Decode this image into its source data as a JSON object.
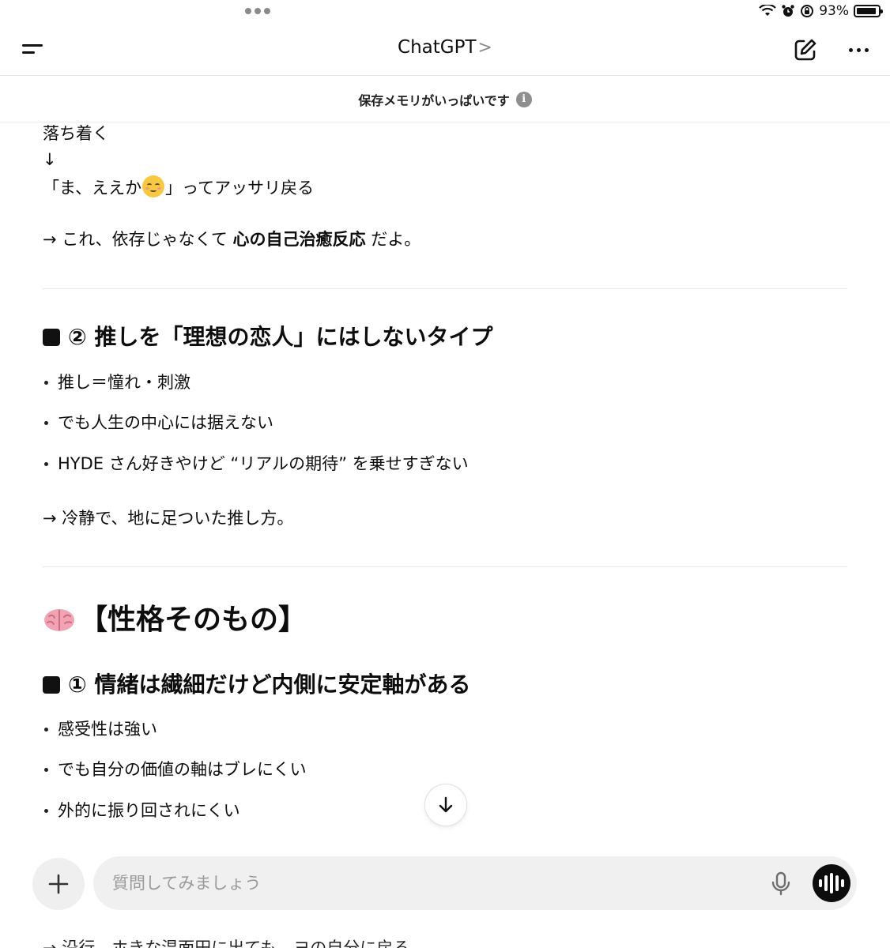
{
  "status_bar": {
    "battery_text": "93%",
    "battery_level": 0.93
  },
  "header": {
    "title": "ChatGPT",
    "chevron": ">"
  },
  "memory_banner": {
    "text": "保存メモリがいっぱいです",
    "info_glyph": "i"
  },
  "message": {
    "line1": "落ち着く",
    "arrow_line": "↓",
    "quote_before": "「ま、ええか",
    "quote_after": "」ってアッサリ戻る",
    "summary1_prefix": "→ これ、依存じゃなくて ",
    "summary1_bold": "心の自己治癒反応",
    "summary1_suffix": " だよ。",
    "section2_heading": "② 推しを「理想の恋人」にはしないタイプ",
    "section2_items": [
      "推し＝憧れ・刺激",
      "でも人生の中心には据えない",
      "HYDE さん好きやけど “リアルの期待” を乗せすぎない"
    ],
    "section2_summary": "→ 冷静で、地に足ついた推し方。",
    "big_heading": "【性格そのもの】",
    "section3_heading": "① 情緒は繊細だけど内側に安定軸がある",
    "section3_items": [
      "感受性は強い",
      "でも自分の価値の軸はブレにくい",
      "外的に振り回されにくい"
    ],
    "cutoff_line": "→ 沿行、ホきな温面田に出ても　ヨの自分に戻る"
  },
  "composer": {
    "placeholder": "質問してみましょう"
  },
  "icons": {
    "menu": "menu-icon",
    "edit": "edit-icon",
    "more": "more-icon",
    "info": "info-icon",
    "brain": "brain-icon",
    "scroll_down": "arrow-down-icon",
    "plus": "plus-icon",
    "mic": "mic-icon",
    "voice": "voice-waveform-icon",
    "wifi": "wifi-icon",
    "alarm": "alarm-icon",
    "lock_rotation": "orientation-lock-icon",
    "battery": "battery-icon"
  },
  "colors": {
    "voice_button": "#0d0d0d",
    "composer_bg": "#f0f0f0",
    "info_badge": "#8e8e8e"
  }
}
